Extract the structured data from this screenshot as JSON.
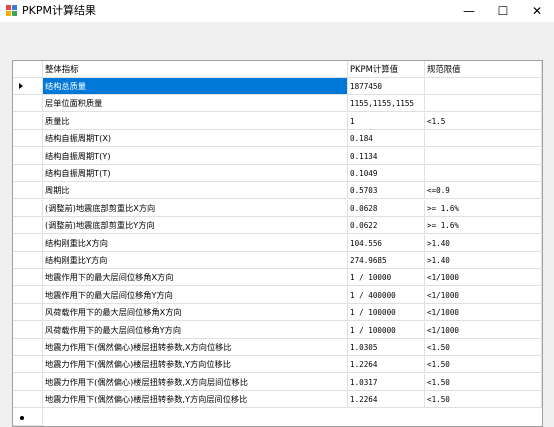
{
  "window": {
    "title": "PKPM计算结果",
    "minimize_glyph": "—",
    "maximize_glyph": "☐",
    "close_glyph": "✕"
  },
  "table": {
    "columns": [
      "整体指标",
      "PKPM计算值",
      "规范限值"
    ],
    "rows": [
      {
        "name": "结构总质量",
        "value": "1877450",
        "limit": ""
      },
      {
        "name": "层单位面积质量",
        "value": "1155,1155,1155",
        "limit": ""
      },
      {
        "name": "质量比",
        "value": "1",
        "limit": "<1.5"
      },
      {
        "name": "结构自振周期T(X)",
        "value": "0.184",
        "limit": ""
      },
      {
        "name": "结构自振周期T(Y)",
        "value": "0.1134",
        "limit": ""
      },
      {
        "name": "结构自振周期T(T)",
        "value": "0.1049",
        "limit": ""
      },
      {
        "name": "周期比",
        "value": "0.5703",
        "limit": "<=0.9"
      },
      {
        "name": "(调整前)地震底部剪重比X方向",
        "value": "0.0628",
        "limit": ">= 1.6%"
      },
      {
        "name": "(调整前)地震底部剪重比Y方向",
        "value": "0.0622",
        "limit": ">= 1.6%"
      },
      {
        "name": "结构刚重比X方向",
        "value": "104.556",
        "limit": ">1.40"
      },
      {
        "name": "结构刚重比Y方向",
        "value": "274.9685",
        "limit": ">1.40"
      },
      {
        "name": "地震作用下的最大层间位移角X方向",
        "value": "1 / 10000",
        "limit": "<1/1000"
      },
      {
        "name": "地震作用下的最大层间位移角Y方向",
        "value": "1 / 400000",
        "limit": "<1/1000"
      },
      {
        "name": "风荷载作用下的最大层间位移角X方向",
        "value": "1 / 100000",
        "limit": "<1/1000"
      },
      {
        "name": "风荷载作用下的最大层间位移角Y方向",
        "value": "1 / 100000",
        "limit": "<1/1000"
      },
      {
        "name": "地震力作用下(偶然偏心)楼层扭转参数,X方向位移比",
        "value": "1.0305",
        "limit": "<1.50"
      },
      {
        "name": "地震力作用下(偶然偏心)楼层扭转参数,Y方向位移比",
        "value": "1.2264",
        "limit": "<1.50"
      },
      {
        "name": "地震力作用下(偶然偏心)楼层扭转参数,X方向层间位移比",
        "value": "1.0317",
        "limit": "<1.50"
      },
      {
        "name": "地震力作用下(偶然偏心)楼层扭转参数,Y方向层间位移比",
        "value": "1.2264",
        "limit": "<1.50"
      }
    ]
  },
  "colors": {
    "selection": "#0078d7",
    "grid_border": "#a0a0a0",
    "client_bg": "#f0f0f0"
  }
}
